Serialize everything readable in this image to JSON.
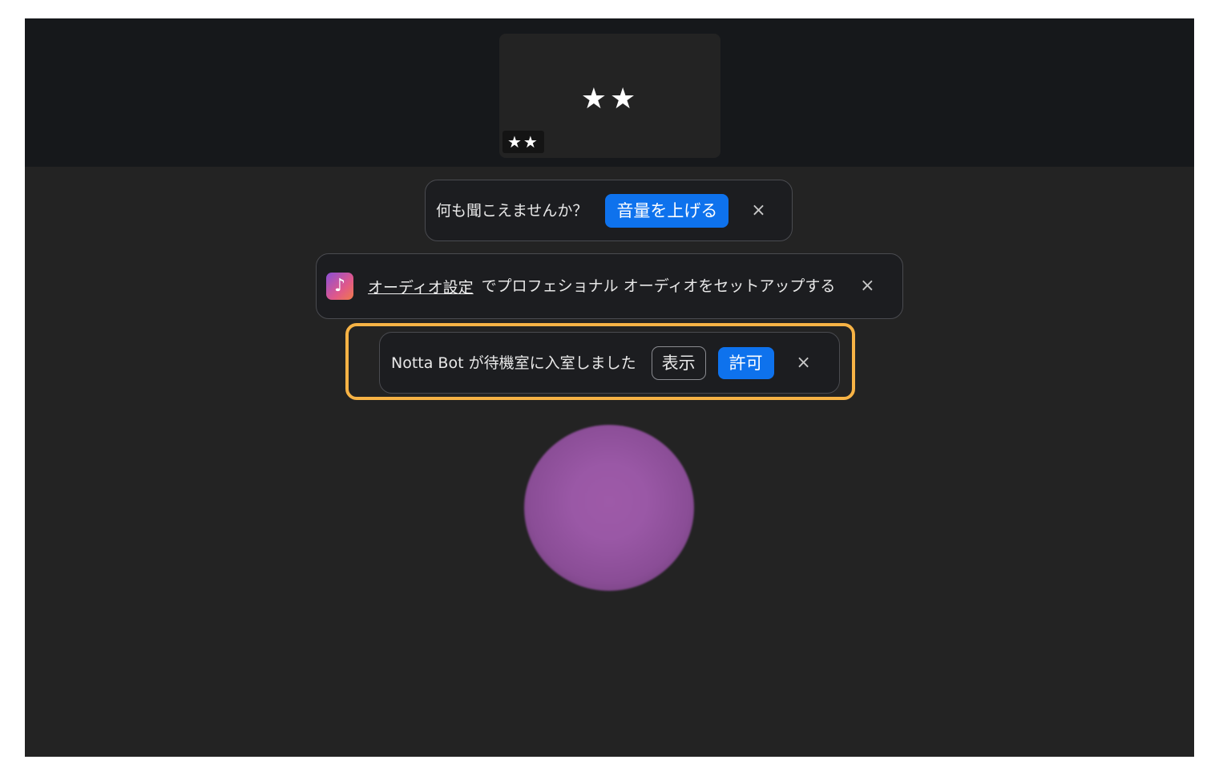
{
  "video_tile": {
    "name_masked": "★★",
    "label_masked": "★★"
  },
  "toasts": {
    "hearing": {
      "message": "何も聞こえませんか？",
      "action_label": "音量を上げる",
      "close_symbol": "×"
    },
    "audio_settings": {
      "icon": "music-note-icon",
      "icon_glyph": "♪",
      "link_label": "オーディオ設定",
      "message": "でプロフェショナル オーディオをセットアップする",
      "close_symbol": "×"
    },
    "waiting_room": {
      "message": "Notta Bot が待機室に入室しました",
      "view_label": "表示",
      "admit_label": "許可",
      "close_symbol": "×"
    }
  },
  "colors": {
    "background": "#232323",
    "top_strip": "#16181b",
    "accent_blue": "#0e72ed",
    "highlight": "#f7b345",
    "avatar": "#9a58a6"
  }
}
